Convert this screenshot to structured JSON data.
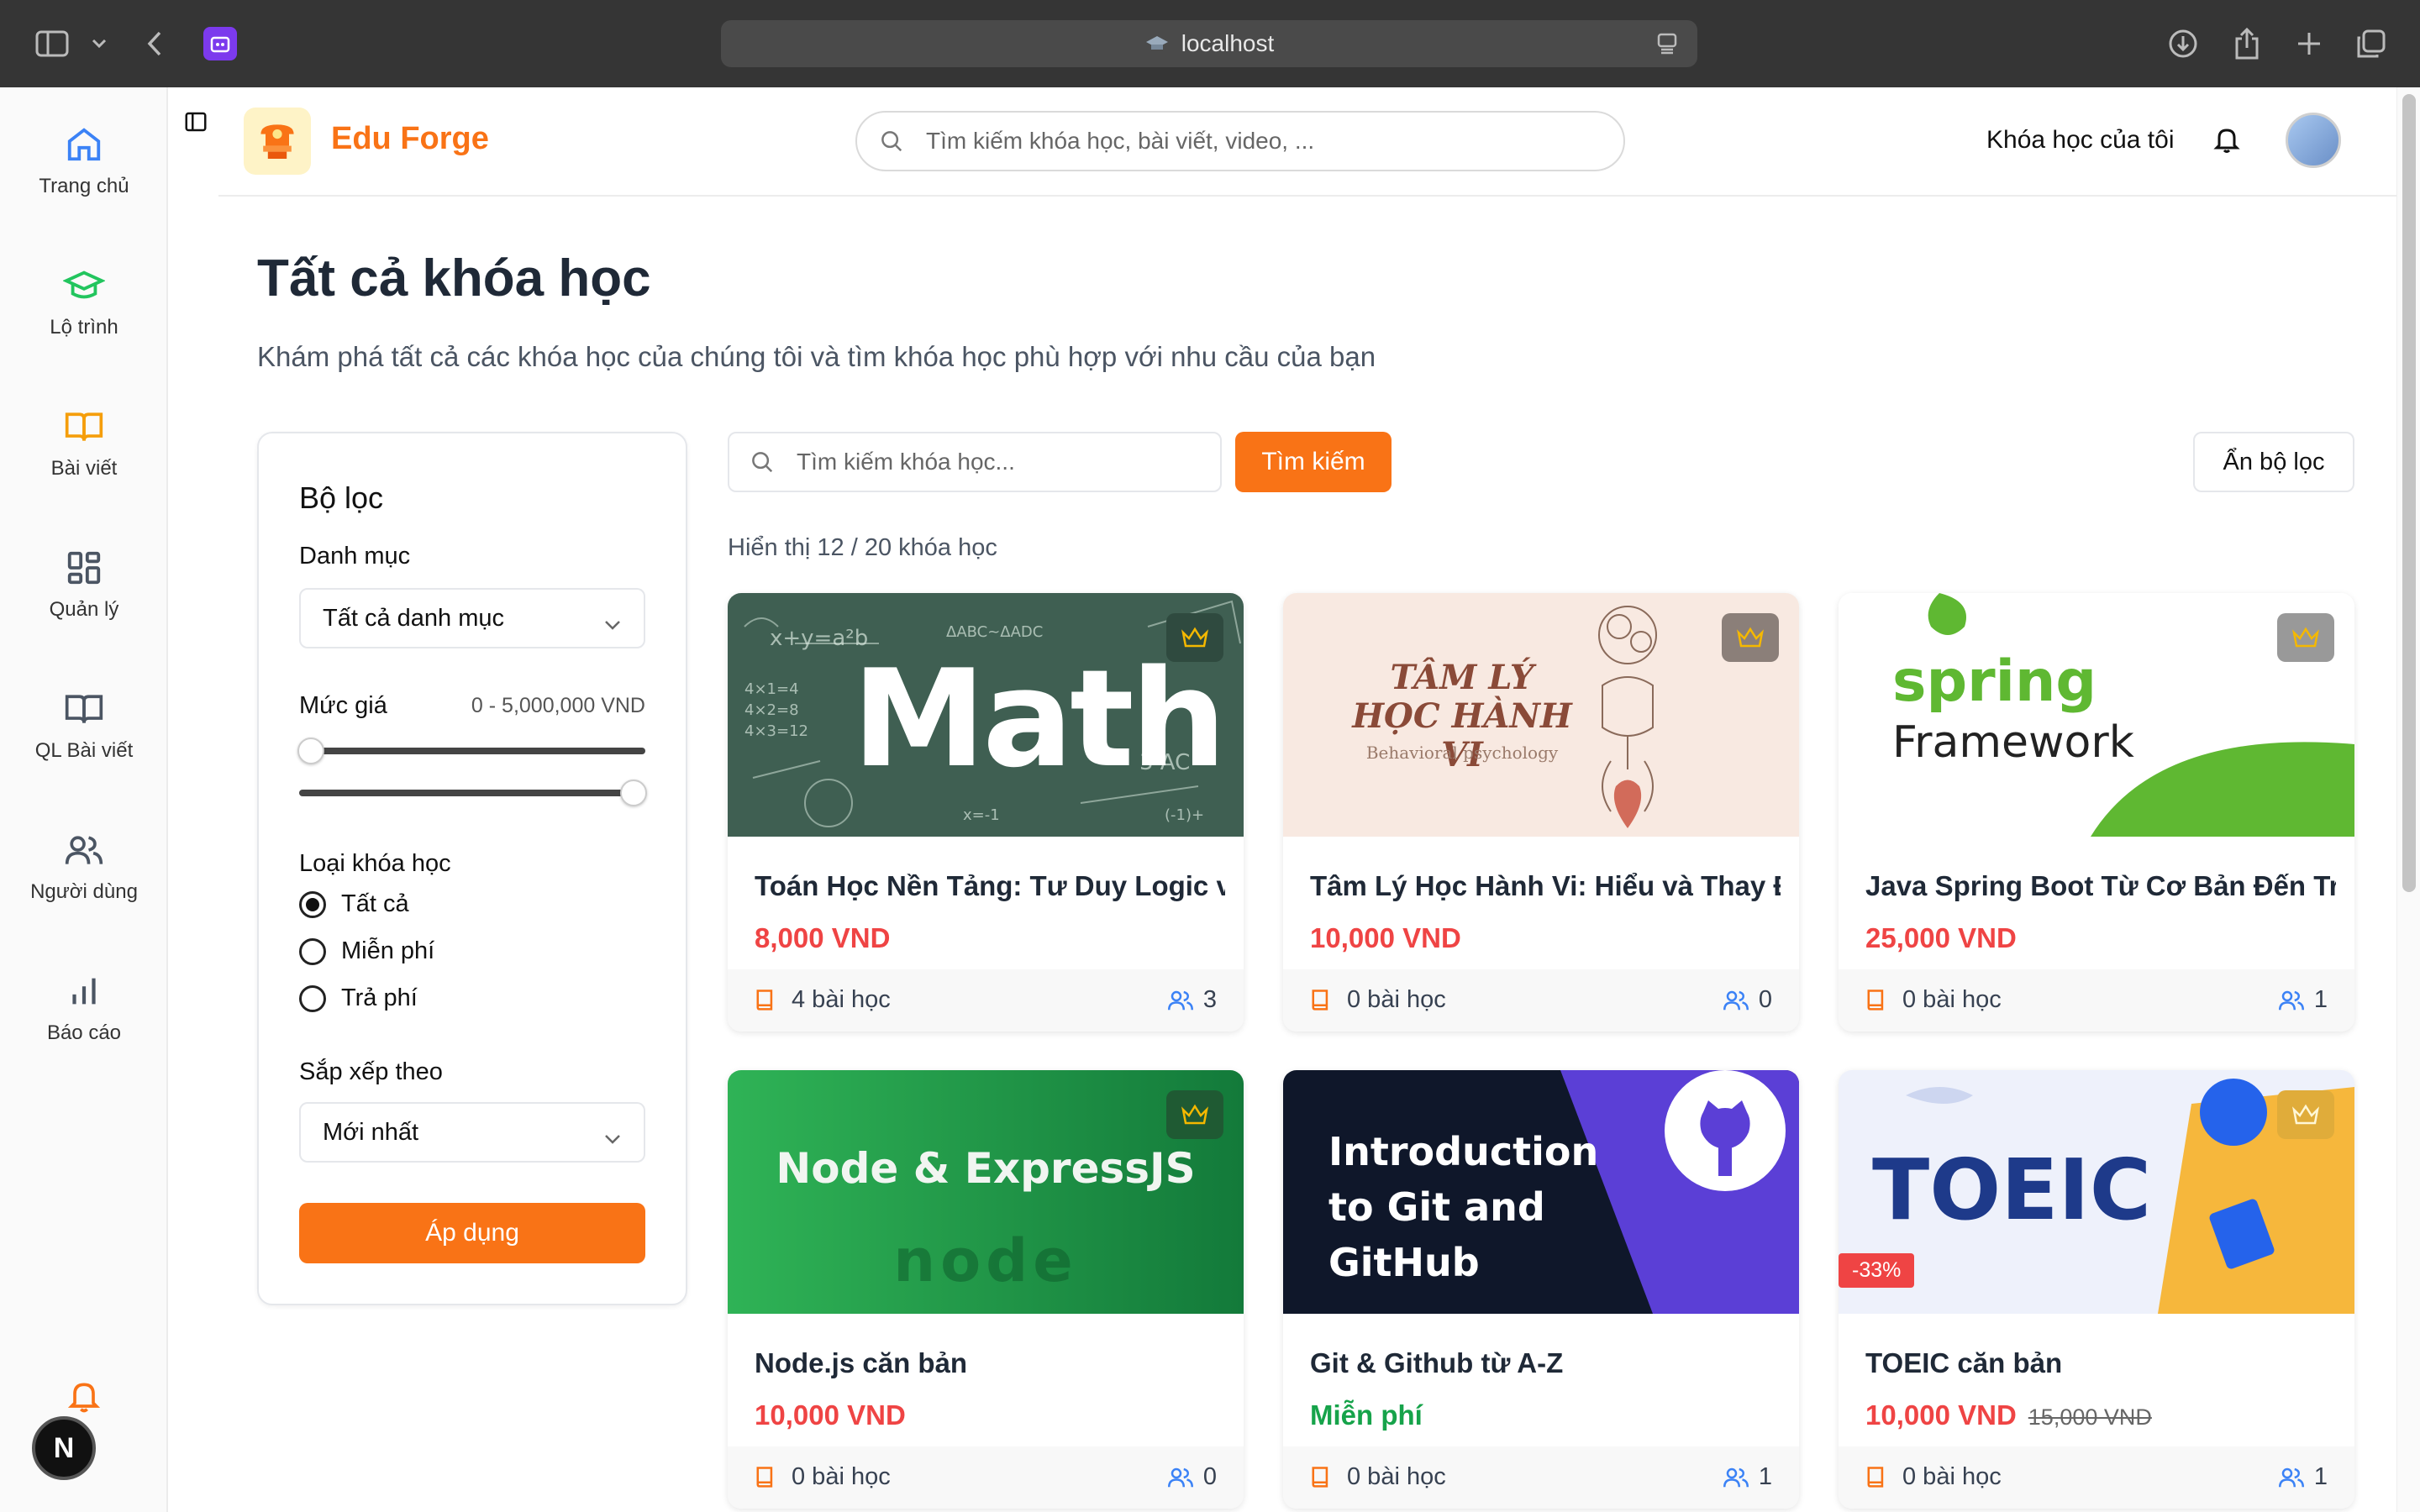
{
  "browser": {
    "url": "localhost"
  },
  "sidebar": {
    "items": [
      {
        "label": "Trang chủ",
        "icon": "home-icon"
      },
      {
        "label": "Lộ trình",
        "icon": "graduation-cap-icon"
      },
      {
        "label": "Bài viết",
        "icon": "book-open-icon"
      },
      {
        "label": "Quản lý",
        "icon": "dashboard-grid-icon"
      },
      {
        "label": "QL Bài viết",
        "icon": "book-icon"
      },
      {
        "label": "Người dùng",
        "icon": "users-icon"
      },
      {
        "label": "Báo cáo",
        "icon": "bar-chart-icon"
      }
    ],
    "avatar_letter": "N"
  },
  "header": {
    "brand": "Edu Forge",
    "search_placeholder": "Tìm kiếm khóa học, bài viết, video, ...",
    "my_courses": "Khóa học của tôi"
  },
  "page": {
    "title": "Tất cả khóa học",
    "subtitle": "Khám phá tất cả các khóa học của chúng tôi và tìm khóa học phù hợp với nhu cầu của bạn"
  },
  "filter": {
    "title": "Bộ lọc",
    "category_label": "Danh mục",
    "category_value": "Tất cả danh mục",
    "price_label": "Mức giá",
    "price_range": "0 - 5,000,000 VND",
    "type_label": "Loại khóa học",
    "type_options": [
      "Tất cả",
      "Miễn phí",
      "Trả phí"
    ],
    "type_selected": 0,
    "sort_label": "Sắp xếp theo",
    "sort_value": "Mới nhất",
    "apply_label": "Áp dụng"
  },
  "course_search": {
    "placeholder": "Tìm kiếm khóa học...",
    "button": "Tìm kiếm",
    "hide_filter": "Ẩn bộ lọc",
    "showing": "Hiển thị 12 / 20 khóa học"
  },
  "courses": [
    {
      "title": "Toán Học Nền Tảng: Tư Duy Logic và Giải Quyết Vấn Đề",
      "price": "8,000 VND",
      "old_price": "",
      "lessons": "4 bài học",
      "students": "3",
      "thumb_text": "Math",
      "badge": ""
    },
    {
      "title": "Tâm Lý Học Hành Vi: Hiểu và Thay Đổi Hành Vi",
      "price": "10,000 VND",
      "old_price": "",
      "lessons": "0 bài học",
      "students": "0",
      "thumb_text": "TÂM LÝ HỌC HÀNH VI",
      "thumb_sub": "Behavioral psychology",
      "badge": ""
    },
    {
      "title": "Java Spring Boot Từ Cơ Bản Đến Triển Khai",
      "price": "25,000 VND",
      "old_price": "",
      "lessons": "0 bài học",
      "students": "1",
      "thumb_text": "spring",
      "thumb_sub": "Framework",
      "badge": ""
    },
    {
      "title": "Node.js căn bản",
      "price": "10,000 VND",
      "old_price": "",
      "lessons": "0 bài học",
      "students": "0",
      "thumb_text": "Node & ExpressJS",
      "badge": ""
    },
    {
      "title": "Git & Github từ A-Z",
      "price": "Miễn phí",
      "old_price": "",
      "lessons": "0 bài học",
      "students": "1",
      "thumb_text": "Introduction to Git and GitHub",
      "badge": ""
    },
    {
      "title": "TOEIC căn bản",
      "price": "10,000 VND",
      "old_price": "15,000 VND",
      "lessons": "0 bài học",
      "students": "1",
      "thumb_text": "TOEIC",
      "badge": "-33%"
    }
  ],
  "colors": {
    "accent": "#f97316",
    "price": "#ef4444",
    "free": "#16a34a",
    "nav_blue": "#3b82f6"
  }
}
